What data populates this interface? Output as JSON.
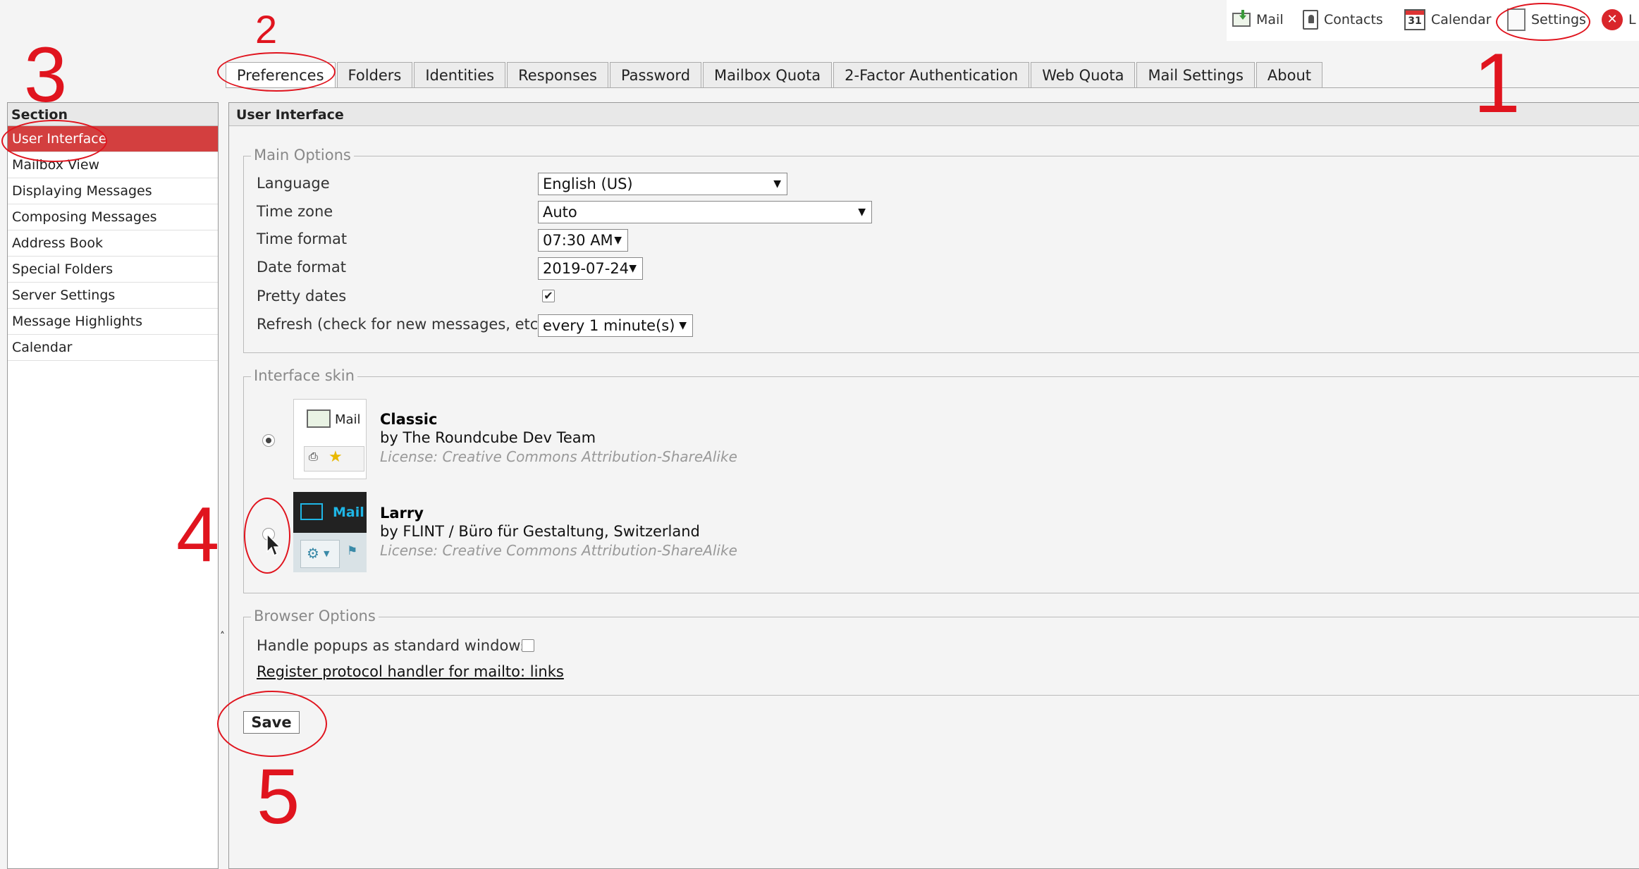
{
  "taskbar": {
    "items": [
      {
        "label": "Mail",
        "icon": "mail-icon"
      },
      {
        "label": "Contacts",
        "icon": "contacts-icon"
      },
      {
        "label": "Calendar",
        "icon": "calendar-icon",
        "icon_text": "31"
      },
      {
        "label": "Settings",
        "icon": "settings-icon"
      },
      {
        "label": "L",
        "icon": "logout-icon"
      }
    ]
  },
  "tabs": [
    "Preferences",
    "Folders",
    "Identities",
    "Responses",
    "Password",
    "Mailbox Quota",
    "2-Factor Authentication",
    "Web Quota",
    "Mail Settings",
    "About"
  ],
  "active_tab": "Preferences",
  "section": {
    "header": "Section",
    "items": [
      "User Interface",
      "Mailbox View",
      "Displaying Messages",
      "Composing Messages",
      "Address Book",
      "Special Folders",
      "Server Settings",
      "Message Highlights",
      "Calendar"
    ],
    "active": "User Interface"
  },
  "main": {
    "header": "User Interface",
    "main_options": {
      "legend": "Main Options",
      "language": {
        "label": "Language",
        "value": "English (US)"
      },
      "timezone": {
        "label": "Time zone",
        "value": "Auto"
      },
      "time_format": {
        "label": "Time format",
        "value": "07:30 AM"
      },
      "date_format": {
        "label": "Date format",
        "value": "2019-07-24"
      },
      "pretty_dates": {
        "label": "Pretty dates",
        "checked": true,
        "mark": "✔"
      },
      "refresh": {
        "label": "Refresh (check for new messages, etc.)",
        "value": "every 1 minute(s)"
      }
    },
    "skin": {
      "legend": "Interface skin",
      "options": [
        {
          "name": "Classic",
          "author": "by The Roundcube Dev Team",
          "license": "License: Creative Commons Attribution-ShareAlike",
          "selected": true,
          "thumb_text": "Mail"
        },
        {
          "name": "Larry",
          "author": "by FLINT / Büro für Gestaltung, Switzerland",
          "license": "License: Creative Commons Attribution-ShareAlike",
          "selected": false,
          "thumb_text": "Mail"
        }
      ]
    },
    "browser_options": {
      "legend": "Browser Options",
      "popups": {
        "label": "Handle popups as standard windows",
        "checked": false
      },
      "protocol_link": "Register protocol handler for mailto: links"
    },
    "save_label": "Save"
  },
  "annotations": {
    "n1": "1",
    "n2": "2",
    "n3": "3",
    "n4": "4",
    "n5": "5",
    "color": "#e0141e"
  },
  "colors": {
    "accent": "#d33f3f"
  }
}
